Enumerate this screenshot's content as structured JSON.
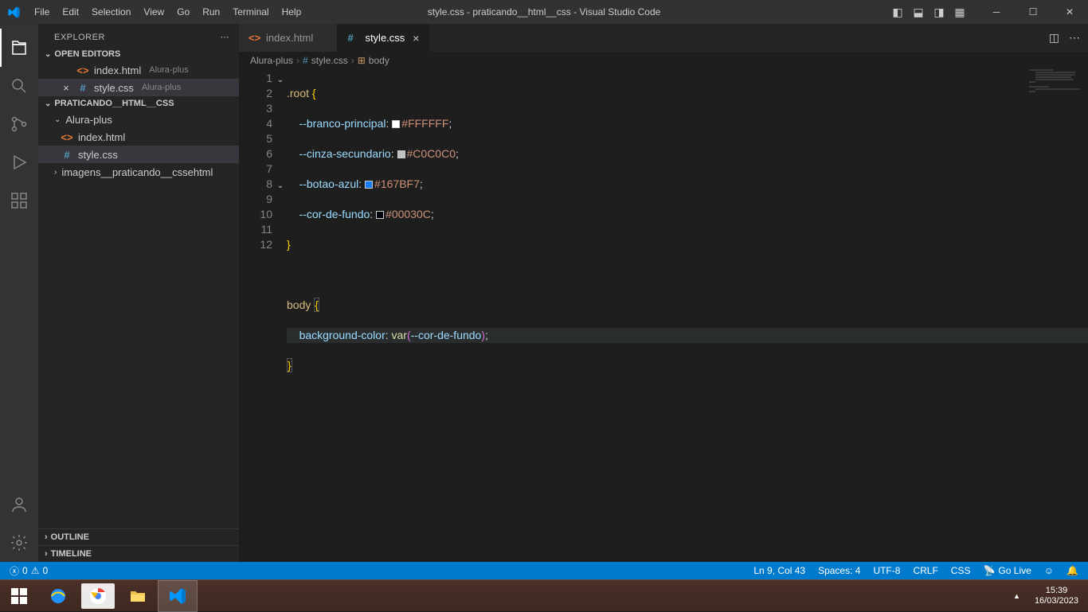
{
  "window": {
    "title": "style.css - praticando__html__css - Visual Studio Code"
  },
  "menu": [
    "File",
    "Edit",
    "Selection",
    "View",
    "Go",
    "Run",
    "Terminal",
    "Help"
  ],
  "explorer": {
    "title": "EXPLORER",
    "open_editors_label": "OPEN EDITORS",
    "workspace_label": "PRATICANDO__HTML__CSS",
    "open_editors": [
      {
        "name": "index.html",
        "desc": "Alura-plus",
        "type": "html",
        "active": false
      },
      {
        "name": "style.css",
        "desc": "Alura-plus",
        "type": "css",
        "active": true
      }
    ],
    "tree": {
      "folder1": "Alura-plus",
      "file1": "index.html",
      "file2": "style.css",
      "folder2": "imagens__praticando__cssehtml"
    },
    "outline_label": "OUTLINE",
    "timeline_label": "TIMELINE"
  },
  "tabs": [
    {
      "name": "index.html",
      "type": "html",
      "active": false
    },
    {
      "name": "style.css",
      "type": "css",
      "active": true
    }
  ],
  "breadcrumb": {
    "seg1": "Alura-plus",
    "seg2": "style.css",
    "seg3": "body"
  },
  "code": {
    "lines": [
      "1",
      "2",
      "3",
      "4",
      "5",
      "6",
      "7",
      "8",
      "9",
      "10",
      "11",
      "12"
    ],
    "l1_sel": ".root",
    "l2_var": "--branco-principal",
    "l2_val": "#FFFFFF",
    "l3_var": "--cinza-secundario",
    "l3_val": "#C0C0C0",
    "l4_var": "--botao-azul",
    "l4_val": "#167BF7",
    "l5_var": "--cor-de-fundo",
    "l5_val": "#00030C",
    "l8_sel": "body",
    "l9_prop": "background-color",
    "l9_func": "var",
    "l9_arg": "--cor-de-fundo"
  },
  "status": {
    "errors": "0",
    "warnings": "0",
    "position": "Ln 9, Col 43",
    "spaces": "Spaces: 4",
    "encoding": "UTF-8",
    "eol": "CRLF",
    "lang": "CSS",
    "golive": "Go Live"
  },
  "system": {
    "time": "15:39",
    "date": "16/03/2023"
  }
}
